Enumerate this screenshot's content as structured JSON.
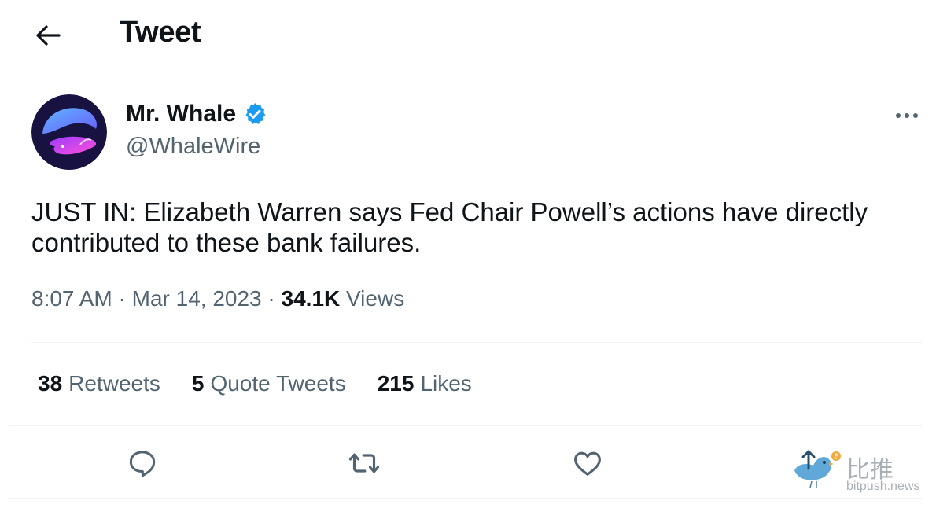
{
  "header": {
    "title": "Tweet",
    "back_icon": "arrow-left-icon"
  },
  "author": {
    "display_name": "Mr. Whale",
    "handle": "@WhaleWire",
    "verified": true,
    "verified_color": "#1d9bf0",
    "avatar_icon": "whale-avatar"
  },
  "tweet": {
    "text": "JUST IN: Elizabeth Warren says Fed Chair Powell’s actions have directly contributed to these bank failures.",
    "time": "8:07 AM",
    "separator": "·",
    "date": "Mar 14, 2023",
    "views_count": "34.1K",
    "views_label": "Views"
  },
  "stats": {
    "retweets_count": "38",
    "retweets_label": "Retweets",
    "quotes_count": "5",
    "quotes_label": "Quote Tweets",
    "likes_count": "215",
    "likes_label": "Likes"
  },
  "actions": [
    {
      "name": "reply",
      "icon": "reply-icon"
    },
    {
      "name": "retweet",
      "icon": "retweet-icon"
    },
    {
      "name": "like",
      "icon": "heart-icon"
    }
  ],
  "watermark": {
    "chinese": "比推",
    "url": "bitpush.news"
  },
  "colors": {
    "text": "#0f1419",
    "secondary": "#536471",
    "divider": "#eff3f4"
  }
}
